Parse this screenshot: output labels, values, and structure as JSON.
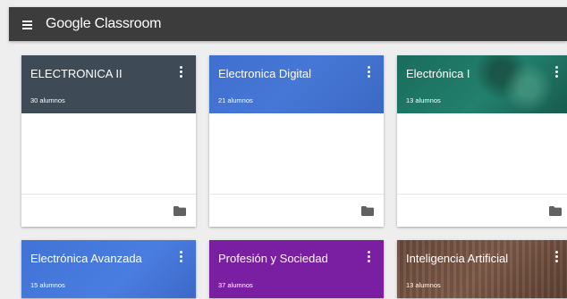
{
  "app": {
    "title": "Google Classroom"
  },
  "cards": [
    {
      "name": "ELECTRONICA II",
      "students": "30 alumnos",
      "color": "#3e4a55"
    },
    {
      "name": "Electronica Digital",
      "students": "21 alumnos",
      "color": "#4677d6"
    },
    {
      "name": "Electrónica I",
      "students": "13 alumnos",
      "color": "#1f7766"
    },
    {
      "name": "Electrónica Avanzada",
      "students": "15 alumnos",
      "color": "#4677d6"
    },
    {
      "name": "Profesión y Sociedad",
      "students": "37 alumnos",
      "color": "#7b1fa2"
    },
    {
      "name": "Inteligencia Artificial",
      "students": "13 alumnos",
      "color": "#6a4a3c"
    }
  ],
  "icons": {
    "menu": "menu-icon",
    "more": "more-vert-icon",
    "folder": "folder-icon"
  }
}
